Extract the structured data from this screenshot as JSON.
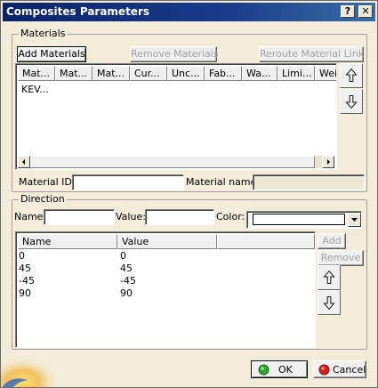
{
  "window": {
    "title": "Composites Parameters",
    "help_label": "?",
    "close_label": "✕"
  },
  "materials": {
    "group_label": "Materials",
    "add_label": "Add Materials",
    "remove_label": "Remove Materials",
    "reroute_label": "Reroute Material Link",
    "columns": [
      "Mat...",
      "Mat...",
      "Mat...",
      "Cur...",
      "Unc...",
      "Fab...",
      "Wa...",
      "Limi...",
      "Weig"
    ],
    "rows": [
      [
        "KEV...",
        "",
        "",
        "",
        "",
        "",
        "",
        "",
        ""
      ]
    ],
    "id_label": "Material ID:",
    "id_value": "",
    "name_label": "Material name :",
    "name_value": ""
  },
  "direction": {
    "group_label": "Direction",
    "name_label": "Name:",
    "name_value": "",
    "value_label": "Value:",
    "value_value": "",
    "color_label": "Color:",
    "color_value": "",
    "columns": [
      "Name",
      "Value"
    ],
    "rows": [
      {
        "name": "0",
        "value": "0"
      },
      {
        "name": "45",
        "value": "45"
      },
      {
        "name": "-45",
        "value": "-45"
      },
      {
        "name": "90",
        "value": "90"
      }
    ],
    "add_label": "Add",
    "remove_label": "Remove"
  },
  "footer": {
    "ok_label": "OK",
    "cancel_label": "Cancel"
  },
  "icons": {
    "move_up": "up-arrow-icon",
    "move_down": "down-arrow-icon",
    "ok": "green-circle-icon",
    "cancel": "red-circle-icon",
    "ok_color": "#2ea82e",
    "cancel_color": "#d02020"
  }
}
